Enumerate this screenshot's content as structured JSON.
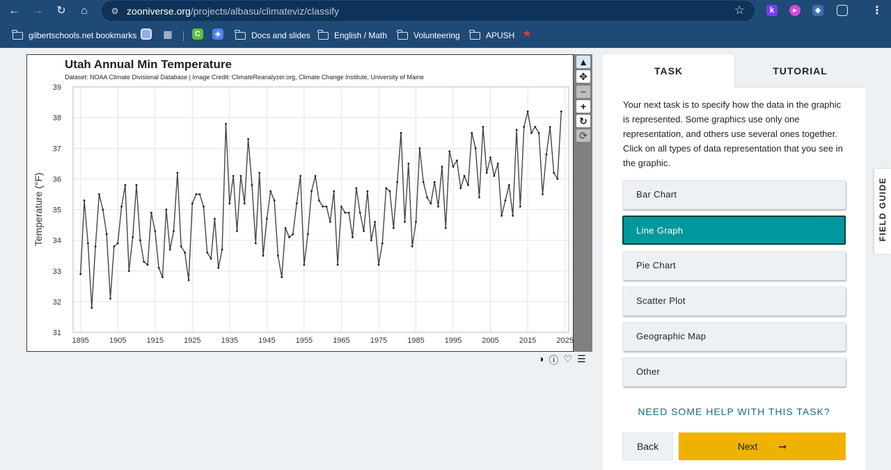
{
  "browser": {
    "url_host": "zooniverse.org",
    "url_path": "/projects/albasu/climateviz/classify",
    "bookmarks": [
      {
        "label": "gilbertschools.net bookmarks"
      },
      {
        "label": "Docs and slides"
      },
      {
        "label": "English / Math"
      },
      {
        "label": "Volunteering"
      },
      {
        "label": "APUSH"
      }
    ]
  },
  "viewer": {
    "controls": {
      "pointer": "▲",
      "move": "✥",
      "zoom_out": "−",
      "zoom_in": "+",
      "rotate": "↻",
      "reset": "⟳"
    },
    "footer_icons": [
      "contrast-icon",
      "info-icon",
      "heart-icon",
      "list-icon"
    ]
  },
  "chart_data": {
    "type": "line",
    "title": "Utah Annual Min Temperature",
    "subtitle": "Dataset: NOAA Climate Divisional Database | Image Credit: ClimateReanalyzer.org, Climate Change Institute, University of Maine",
    "ylabel": "Temperature (°F)",
    "xlabel": "",
    "xlim": [
      1893,
      2026
    ],
    "ylim": [
      31,
      39
    ],
    "xticks": [
      1895,
      1905,
      1915,
      1925,
      1935,
      1945,
      1955,
      1965,
      1975,
      1985,
      1995,
      2005,
      2015,
      2025
    ],
    "yticks": [
      31,
      32,
      33,
      34,
      35,
      36,
      37,
      38,
      39
    ],
    "grid": true,
    "color": "#444444",
    "x_start": 1895,
    "values": [
      32.9,
      35.3,
      33.9,
      31.8,
      33.8,
      35.5,
      35.0,
      34.2,
      32.1,
      33.8,
      33.9,
      35.1,
      35.8,
      33.0,
      34.1,
      35.8,
      34.0,
      33.3,
      33.2,
      34.9,
      34.3,
      33.1,
      32.8,
      35.0,
      33.7,
      34.3,
      36.2,
      33.8,
      33.6,
      32.7,
      35.2,
      35.5,
      35.5,
      35.1,
      33.6,
      33.4,
      34.7,
      33.1,
      33.7,
      37.8,
      35.2,
      36.1,
      34.3,
      36.1,
      35.2,
      37.3,
      35.8,
      33.9,
      36.2,
      33.5,
      34.7,
      35.6,
      35.3,
      33.5,
      32.8,
      34.4,
      34.1,
      34.2,
      35.2,
      36.1,
      33.2,
      34.2,
      35.6,
      36.1,
      35.3,
      35.1,
      35.1,
      34.6,
      35.6,
      33.2,
      35.1,
      34.9,
      34.9,
      34.1,
      35.7,
      34.9,
      34.3,
      35.6,
      34.0,
      34.6,
      33.2,
      33.9,
      35.7,
      35.6,
      34.4,
      35.9,
      37.5,
      34.6,
      36.5,
      33.8,
      34.6,
      37.0,
      35.9,
      35.4,
      35.2,
      35.9,
      35.1,
      36.4,
      34.4,
      36.9,
      36.4,
      36.6,
      35.7,
      36.1,
      35.8,
      37.5,
      37.0,
      35.4,
      37.7,
      36.2,
      36.7,
      36.1,
      36.5,
      34.8,
      35.3,
      35.8,
      34.8,
      37.6,
      35.1,
      37.7,
      38.2,
      37.5,
      37.7,
      37.5,
      35.5,
      36.8,
      37.7,
      36.2,
      36.0,
      38.2
    ]
  },
  "task": {
    "tabs": {
      "task": "TASK",
      "tutorial": "TUTORIAL"
    },
    "instructions": "Your next task is to specify how the data in the graphic is represented. Some graphics use only one representation, and others use several ones together. Click on all types of data representation that you see in the graphic.",
    "answers": [
      "Bar Chart",
      "Line Graph",
      "Pie Chart",
      "Scatter Plot",
      "Geographic Map",
      "Other"
    ],
    "selected": "Line Graph",
    "help": "NEED SOME HELP WITH THIS TASK?",
    "back": "Back",
    "next": "Next",
    "next_arrow": "➞",
    "field_guide": "FIELD GUIDE"
  },
  "colors": {
    "chrome": "#1f4a75",
    "accent": "#00979d",
    "next_button": "#f0b200"
  }
}
